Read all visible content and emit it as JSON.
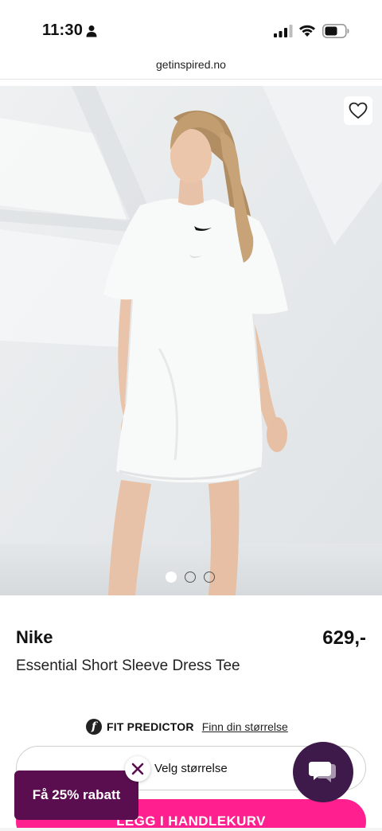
{
  "status_bar": {
    "time": "11:30"
  },
  "browser": {
    "url": "getinspired.no"
  },
  "product": {
    "brand": "Nike",
    "name": "Essential Short Sleeve Dress Tee",
    "price": "629,-",
    "image_count": 3,
    "active_image": 1
  },
  "fit_predictor": {
    "title": "FIT PREDICTOR",
    "link": "Finn din størrelse"
  },
  "size_select": {
    "label": "Velg størrelse"
  },
  "cart": {
    "label": "LEGG I HANDLEKURV"
  },
  "promo": {
    "label": "Få 25% rabatt"
  },
  "icons": {
    "status": [
      "person-icon",
      "signal-icon",
      "wifi-icon",
      "battery-icon"
    ],
    "wishlist": "heart-icon",
    "promo_close": "close-icon",
    "chat": "chat-icon",
    "fit": "fit-predictor-icon"
  },
  "colors": {
    "accent": "#ff1f8e",
    "promo_bg": "#5a0e4f",
    "chat_bg": "#3d1a4a"
  }
}
